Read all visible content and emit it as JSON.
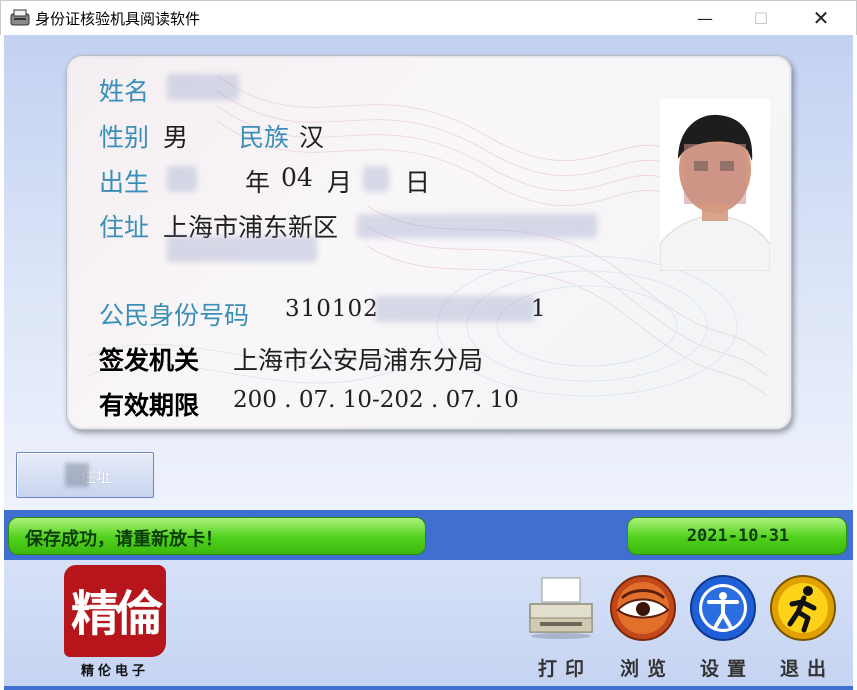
{
  "window": {
    "title": "身份证核验机具阅读软件",
    "minimize": "—",
    "maximize": "☐",
    "close": "✕"
  },
  "card": {
    "name_label": "姓名",
    "name_value": "",
    "sex_label": "性别",
    "sex_value": "男",
    "ethnic_label": "民族",
    "ethnic_value": "汉",
    "birth_label": "出生",
    "birth_year_unit": "年",
    "birth_month": "04",
    "birth_month_unit": "月",
    "birth_day_unit": "日",
    "address_label": "住址",
    "address_value": "上海市浦东新区",
    "id_label": "公民身份号码",
    "id_value": "310102",
    "id_tail": "1",
    "authority_label": "签发机关",
    "authority_value": "上海市公安局浦东分局",
    "validity_label": "有效期限",
    "validity_value": "200 . 07. 10-202 . 07. 10"
  },
  "address_button": {
    "label": "住址"
  },
  "status": {
    "message": "保存成功，请重新放卡！",
    "date": "2021-10-31"
  },
  "logo": {
    "glyphs": "精倫",
    "caption": "精伦电子"
  },
  "toolbar": [
    {
      "id": "print",
      "label": "打印",
      "icon": "printer-icon"
    },
    {
      "id": "browse",
      "label": "浏览",
      "icon": "eye-icon"
    },
    {
      "id": "settings",
      "label": "设置",
      "icon": "accessibility-icon"
    },
    {
      "id": "exit",
      "label": "退出",
      "icon": "running-man-icon"
    }
  ],
  "colors": {
    "window_blue": "#3f6fd1",
    "label_blue": "#3a8fb8",
    "status_green": "#4fd11b",
    "logo_red": "#b6161b"
  }
}
